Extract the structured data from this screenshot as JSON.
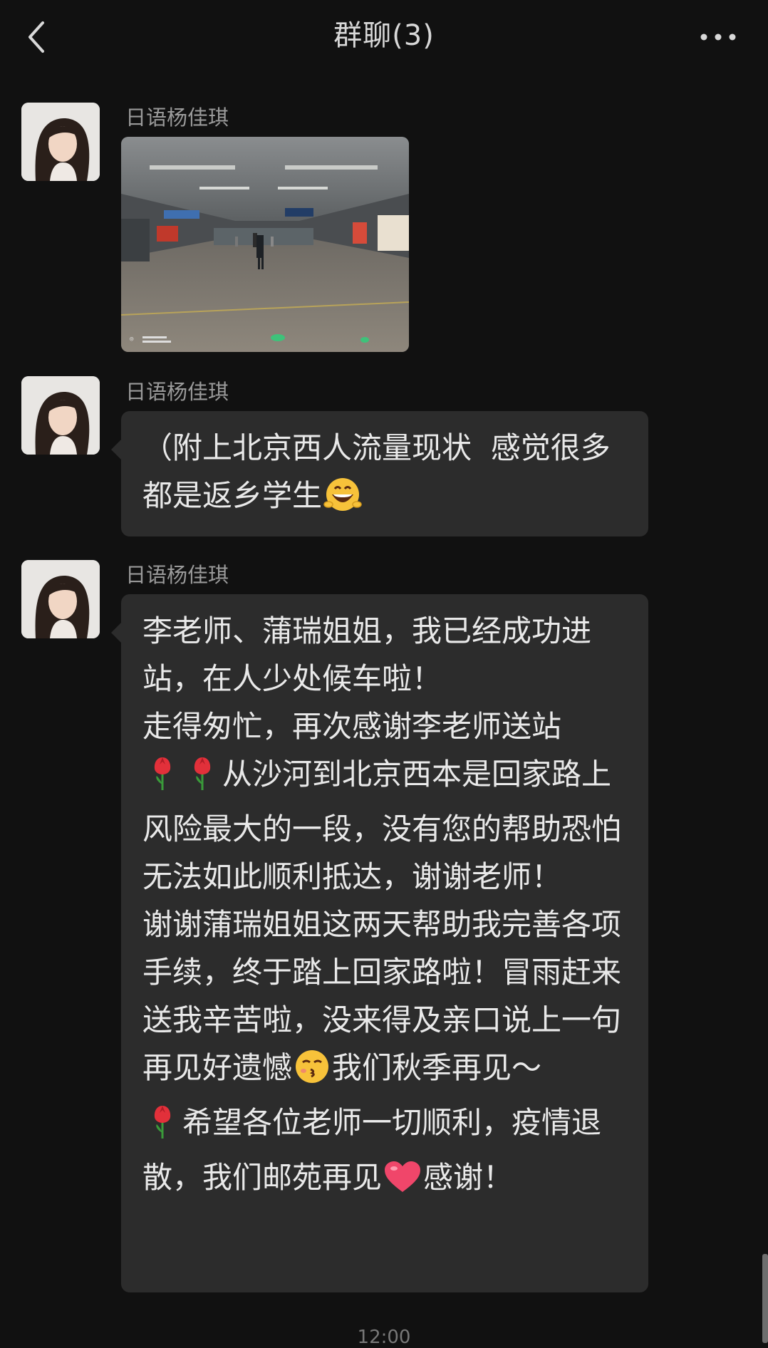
{
  "header": {
    "title": "群聊(3)",
    "back_icon": "chevron-left-icon",
    "more_icon": "ellipsis-icon"
  },
  "messages": [
    {
      "sender": "日语杨佳琪",
      "type": "image",
      "image_description": "photo"
    },
    {
      "sender": "日语杨佳琪",
      "type": "text",
      "parts": [
        {
          "text": "（附上北京西人流量现状  感觉很多都是返乡学生"
        },
        {
          "emoji": "grinning-face-icon"
        }
      ]
    },
    {
      "sender": "日语杨佳琪",
      "type": "text",
      "lines": [
        "李老师、蒲瑞姐姐，我已经成功进站，在人少处候车啦！",
        "走得匆忙，再次感谢李老师送站",
        "从沙河到北京西本是回家路上风险最大的一段，没有您的帮助恐怕无法如此顺利抵达，谢谢老师！",
        "谢谢蒲瑞姐姐这两天帮助我完善各项手续，终于踏上回家路啦！冒雨赶来送我辛苦啦，没来得及亲口说上一句再见好遗憾",
        "我们秋季再见～",
        "希望各位老师一切顺利，疫情退散，我们邮苑再见",
        "感谢！"
      ]
    }
  ],
  "timestamp": "12:00",
  "colors": {
    "background": "#111111",
    "bubble": "#2c2c2c",
    "text": "#e9e9e9",
    "sender": "#9a9a9a"
  }
}
